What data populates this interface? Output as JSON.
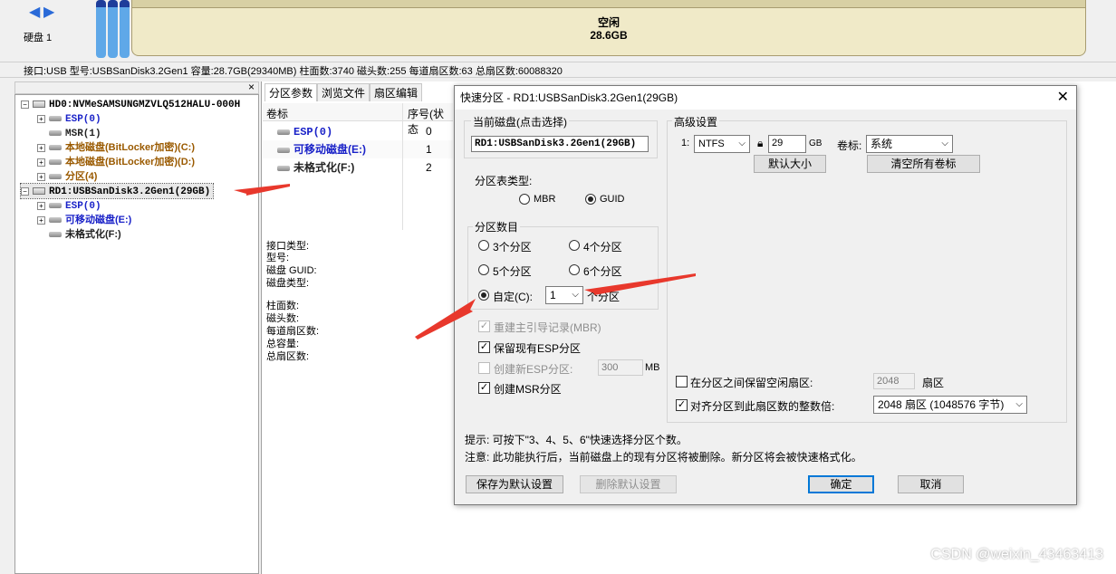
{
  "topbar": {
    "disk_label": "硬盘 1",
    "free_label": "空闲",
    "free_size": "28.6GB"
  },
  "infobar": {
    "text": "接口:USB  型号:USBSanDisk3.2Gen1  容量:28.7GB(29340MB)  柱面数:3740  磁头数:255  每道扇区数:63  总扇区数:60088320"
  },
  "tree": {
    "items": [
      {
        "label": "HD0:NVMeSAMSUNGMZVLQ512HALU-000H"
      },
      {
        "label": "ESP(0)"
      },
      {
        "label": "MSR(1)"
      },
      {
        "label": "本地磁盘(BitLocker加密)(C:)"
      },
      {
        "label": "本地磁盘(BitLocker加密)(D:)"
      },
      {
        "label": "分区(4)"
      },
      {
        "label": "RD1:USBSanDisk3.2Gen1(29GB)"
      },
      {
        "label": "ESP(0)"
      },
      {
        "label": "可移动磁盘(E:)"
      },
      {
        "label": "未格式化(F:)"
      }
    ]
  },
  "tabs": [
    "分区参数",
    "浏览文件",
    "扇区编辑"
  ],
  "grid": {
    "headers": [
      "卷标",
      "序号(状态"
    ],
    "rows": [
      {
        "name": "ESP(0)",
        "index": "0"
      },
      {
        "name": "可移动磁盘(E:)",
        "index": "1"
      },
      {
        "name": "未格式化(F:)",
        "index": "2"
      }
    ]
  },
  "info_labels": [
    "接口类型:",
    "型号:",
    "磁盘 GUID:",
    "磁盘类型:",
    "柱面数:",
    "磁头数:",
    "每道扇区数:",
    "总容量:",
    "总扇区数:"
  ],
  "dialog": {
    "title": "快速分区 - RD1:USBSanDisk3.2Gen1(29GB)",
    "current_disk_group": "当前磁盘(点击选择)",
    "current_disk": "RD1:USBSanDisk3.2Gen1(29GB)",
    "table_type_label": "分区表类型:",
    "mbr": "MBR",
    "guid": "GUID",
    "count_group": "分区数目",
    "opt3": "3个分区",
    "opt4": "4个分区",
    "opt5": "5个分区",
    "opt6": "6个分区",
    "custom": "自定(C):",
    "custom_value": "1",
    "custom_suffix": "个分区",
    "rebuild_mbr": "重建主引导记录(MBR)",
    "keep_esp": "保留现有ESP分区",
    "create_esp": "创建新ESP分区:",
    "esp_size": "300",
    "esp_unit": "MB",
    "create_msr": "创建MSR分区",
    "advanced": "高级设置",
    "part_index": "1:",
    "fs": "NTFS",
    "size": "29",
    "size_unit": "GB",
    "volume_label": "卷标:",
    "volume_value": "系统",
    "default_size": "默认大小",
    "clear_labels": "清空所有卷标",
    "keep_free": "在分区之间保留空闲扇区:",
    "keep_free_value": "2048",
    "keep_free_unit": "扇区",
    "align": "对齐分区到此扇区数的整数倍:",
    "align_value": "2048 扇区 (1048576 字节)",
    "hint": "提示: 可按下\"3、4、5、6\"快速选择分区个数。",
    "note": "注意: 此功能执行后，当前磁盘上的现有分区将被删除。新分区将会被快速格式化。",
    "save_default": "保存为默认设置",
    "delete_default": "删除默认设置",
    "ok": "确定",
    "cancel": "取消"
  },
  "watermark": "CSDN @weixin_43463413",
  "colors": {
    "annotation_arrow": "#e8382c",
    "selection": "#0078d7"
  }
}
